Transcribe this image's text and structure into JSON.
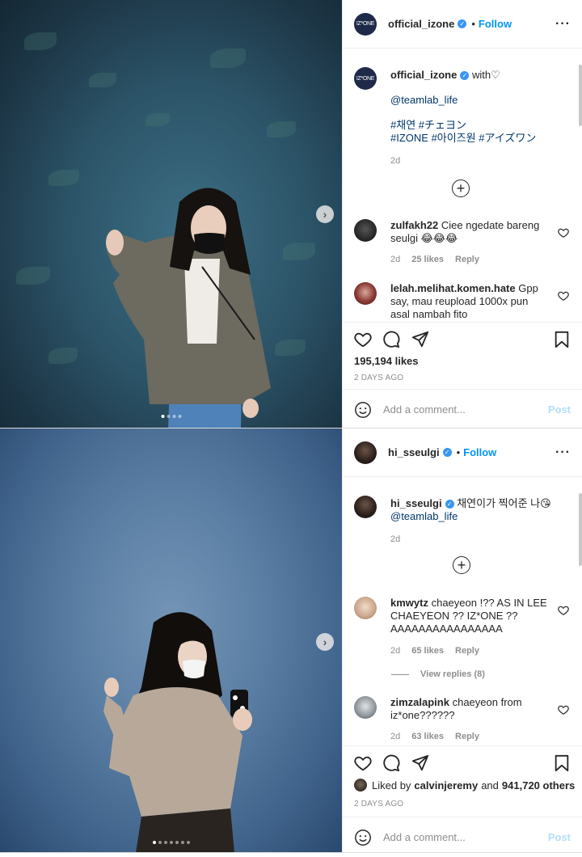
{
  "post1": {
    "username": "official_izone",
    "avatar_text": "IZ*ONE",
    "follow_label": "Follow",
    "caption": {
      "username": "official_izone",
      "text": "with",
      "mention": "@teamlab_life",
      "hashtags_line1": "#채연 #チェヨン",
      "hashtags_line2": "#IZONE #아이즈원 #アイズワン",
      "age": "2d"
    },
    "comments": [
      {
        "username": "zulfakh22",
        "text": "Ciee ngedate bareng seulgi 😂😂😂",
        "age": "2d",
        "likes": "25 likes",
        "reply": "Reply"
      },
      {
        "username": "lelah.melihat.komen.hate",
        "text": "Gpp say, mau reupload 1000x pun asal nambah fito"
      }
    ],
    "likes": "195,194 likes",
    "date": "2 DAYS AGO",
    "add_comment_placeholder": "Add a comment...",
    "post_label": "Post"
  },
  "post2": {
    "username": "hi_sseulgi",
    "follow_label": "Follow",
    "caption": {
      "username": "hi_sseulgi",
      "text": "채연이가 찍어준 나😘",
      "mention": "@teamlab_life",
      "age": "2d"
    },
    "comments": [
      {
        "username": "kmwytz",
        "text": "chaeyeon !?? AS IN LEE CHAEYEON ?? IZ*ONE ?? AAAAAAAAAAAAAAAA",
        "age": "2d",
        "likes": "65 likes",
        "reply": "Reply",
        "view_replies": "View replies (8)"
      },
      {
        "username": "zimzalapink",
        "text": "chaeyeon from iz*one??????",
        "age": "2d",
        "likes": "63 likes",
        "reply": "Reply"
      }
    ],
    "liked_by_prefix": "Liked by",
    "liked_by_user": "calvinjeremy",
    "liked_by_and": "and",
    "liked_by_others": "941,720 others",
    "date": "2 DAYS AGO",
    "add_comment_placeholder": "Add a comment...",
    "post_label": "Post"
  },
  "icons": [
    "heart-icon",
    "comment-icon",
    "share-icon",
    "bookmark-icon",
    "more-icon",
    "plus-circle-icon",
    "smile-icon",
    "chevron-right-icon",
    "verified-icon"
  ],
  "colors": {
    "link": "#0095f6",
    "verified": "#3897f0",
    "muted": "#8e8e8e",
    "post_disabled": "#b2dffc"
  }
}
